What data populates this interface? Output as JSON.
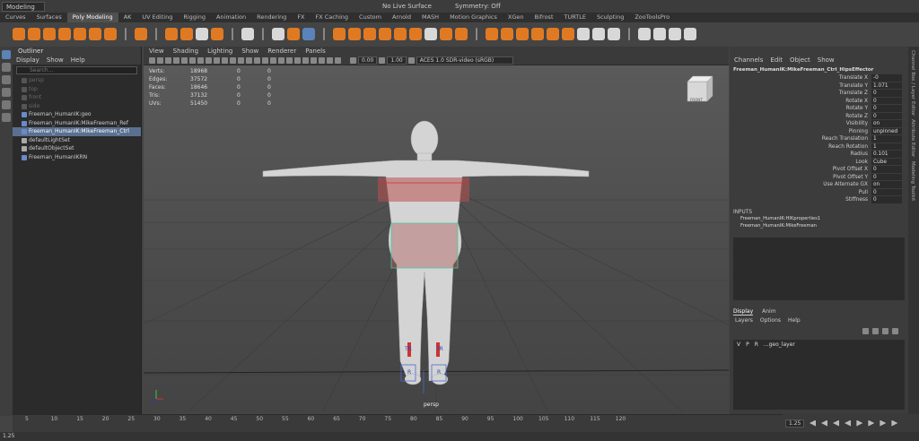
{
  "topbar": {
    "mode": "Modeling",
    "live_surface": "No Live Surface",
    "symmetry": "Symmetry: Off"
  },
  "shelf_tabs": [
    "Curves",
    "Surfaces",
    "Poly Modeling",
    "AK",
    "UV Editing",
    "Rigging",
    "Animation",
    "Rendering",
    "FX",
    "FX Caching",
    "Custom",
    "Arnold",
    "MASH",
    "Motion Graphics",
    "XGen",
    "Bifrost",
    "TURTLE",
    "Sculpting",
    "ZooToolsPro"
  ],
  "active_shelf_tab": "Poly Modeling",
  "outliner": {
    "title": "Outliner",
    "menu": [
      "Display",
      "Show",
      "Help"
    ],
    "search_placeholder": "Search...",
    "items": [
      {
        "label": "persp",
        "dim": true
      },
      {
        "label": "top",
        "dim": true
      },
      {
        "label": "front",
        "dim": true
      },
      {
        "label": "side",
        "dim": true
      },
      {
        "label": "Freeman_HumanIK:geo",
        "dim": false
      },
      {
        "label": "Freeman_HumanIK:MikeFreeman_Ref",
        "dim": false
      },
      {
        "label": "Freeman_HumanIK:MikeFreeman_Ctrl",
        "dim": false,
        "selected": true
      },
      {
        "label": "defaultLightSet",
        "dim": false
      },
      {
        "label": "defaultObjectSet",
        "dim": false
      },
      {
        "label": "Freeman_HumanIKRN",
        "dim": false
      }
    ]
  },
  "viewport": {
    "menu": [
      "View",
      "Shading",
      "Lighting",
      "Show",
      "Renderer",
      "Panels"
    ],
    "exposure": "0.00",
    "gamma": "1.00",
    "colorspace": "ACES 1.0 SDR-video (sRGB)",
    "camera_label": "persp",
    "viewcube": "FRONT",
    "stats": [
      {
        "label": "Verts:",
        "v1": "18968",
        "v2": "0",
        "v3": "0"
      },
      {
        "label": "Edges:",
        "v1": "37572",
        "v2": "0",
        "v3": "0"
      },
      {
        "label": "Faces:",
        "v1": "18646",
        "v2": "0",
        "v3": "0"
      },
      {
        "label": "Tris:",
        "v1": "37132",
        "v2": "0",
        "v3": "0"
      },
      {
        "label": "UVs:",
        "v1": "51450",
        "v2": "0",
        "v3": "0"
      }
    ]
  },
  "channelbox": {
    "menu": [
      "Channels",
      "Edit",
      "Object",
      "Show"
    ],
    "object": "Freeman_HumanIK:MikeFreeman_Ctrl_HipsEffector",
    "attrs": [
      {
        "label": "Translate X",
        "value": "-0"
      },
      {
        "label": "Translate Y",
        "value": "1.071"
      },
      {
        "label": "Translate Z",
        "value": "0"
      },
      {
        "label": "Rotate X",
        "value": "0"
      },
      {
        "label": "Rotate Y",
        "value": "0"
      },
      {
        "label": "Rotate Z",
        "value": "0"
      },
      {
        "label": "Visibility",
        "value": "on"
      },
      {
        "label": "Pinning",
        "value": "unpinned"
      },
      {
        "label": "Reach Translation",
        "value": "1"
      },
      {
        "label": "Reach Rotation",
        "value": "1"
      },
      {
        "label": "Radius",
        "value": "0.101"
      },
      {
        "label": "Look",
        "value": "Cube"
      },
      {
        "label": "Pivot Offset X",
        "value": "0"
      },
      {
        "label": "Pivot Offset Y",
        "value": "0"
      },
      {
        "label": "Use Alternate GX",
        "value": "on"
      },
      {
        "label": "Pull",
        "value": "0"
      },
      {
        "label": "Stiffness",
        "value": "0"
      }
    ],
    "inputs_title": "INPUTS",
    "inputs": [
      "Freeman_HumanIK:HIKproperties1",
      "Freeman_HumanIK:MikeFreeman"
    ]
  },
  "layers": {
    "tabs": [
      "Display",
      "Anim"
    ],
    "menu": [
      "Layers",
      "Options",
      "Help"
    ],
    "row": {
      "v": "V",
      "p": "P",
      "r": "R",
      "name": "...geo_layer"
    }
  },
  "side_tabs": [
    "Channel Box / Layer Editor",
    "Attribute Editor",
    "Modeling Toolkit"
  ],
  "timeline": {
    "ticks": [
      "5",
      "10",
      "15",
      "20",
      "25",
      "30",
      "35",
      "40",
      "45",
      "50",
      "55",
      "60",
      "65",
      "70",
      "75",
      "80",
      "85",
      "90",
      "95",
      "100",
      "105",
      "110",
      "115",
      "120"
    ],
    "current_frame": "1.25",
    "start": "1.25"
  },
  "colors": {
    "accent": "#e07a22",
    "selection": "#5a7090",
    "panel": "#3c3c3c"
  }
}
